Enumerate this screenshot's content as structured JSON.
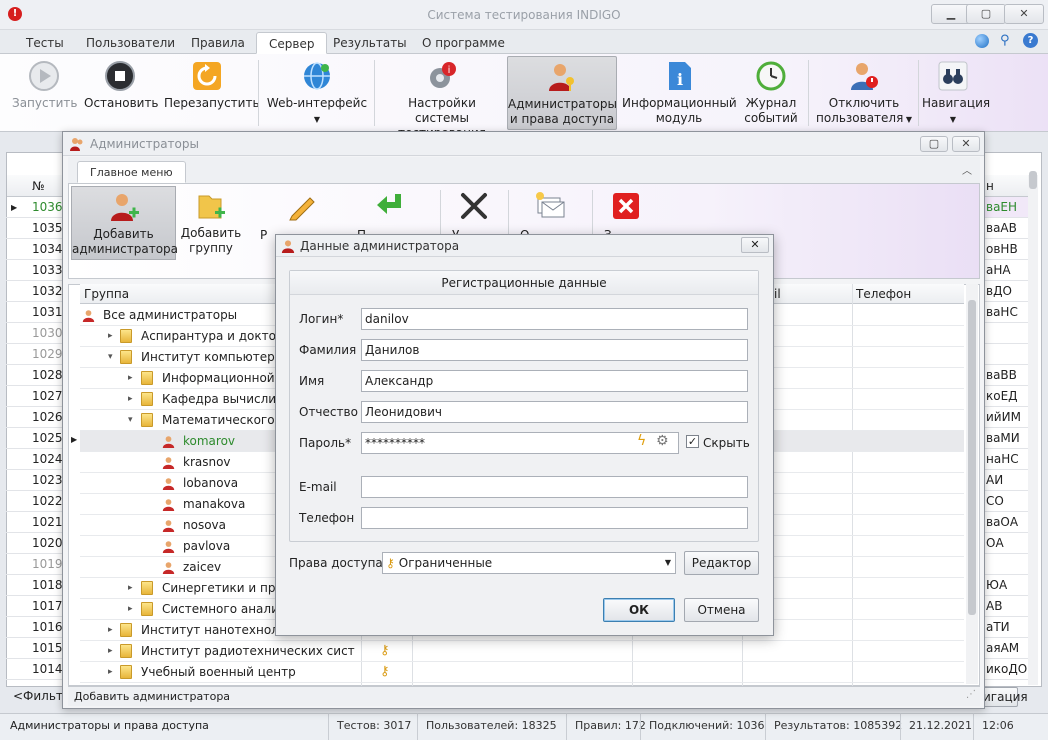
{
  "app": {
    "title": "Система тестирования INDIGO"
  },
  "main_tabs": [
    "Тесты",
    "Пользователи",
    "Правила",
    "Сервер",
    "Результаты",
    "О программе"
  ],
  "ribbon": {
    "start": "Запустить",
    "stop": "Остановить",
    "restart": "Перезапустить",
    "web": "Web-интерфейс",
    "settings_1": "Настройки системы",
    "settings_2": "тестирования",
    "admins_1": "Администраторы",
    "admins_2": "и права доступа",
    "info_1": "Информационный",
    "info_2": "модуль",
    "log_1": "Журнал",
    "log_2": "событий",
    "disconnect_1": "Отключить",
    "disconnect_2": "пользователя",
    "nav": "Навигация"
  },
  "bg_grid": {
    "col_no": "№",
    "col_right": "н",
    "rows": [
      {
        "no": "1036",
        "right": "ваЕН",
        "green": true
      },
      {
        "no": "1035",
        "right": "ваАВ"
      },
      {
        "no": "1034",
        "right": "овНВ"
      },
      {
        "no": "1033",
        "right": "аНА"
      },
      {
        "no": "1032",
        "right": "вДО"
      },
      {
        "no": "1031",
        "right": "ваНС"
      },
      {
        "no": "1030",
        "right": "",
        "grey": true
      },
      {
        "no": "1029",
        "right": "",
        "grey": true
      },
      {
        "no": "1028",
        "right": "ваВВ"
      },
      {
        "no": "1027",
        "right": "коЕД"
      },
      {
        "no": "1026",
        "right": "ийИМ"
      },
      {
        "no": "1025",
        "right": "ваМИ"
      },
      {
        "no": "1024",
        "right": "наНС"
      },
      {
        "no": "1023",
        "right": "АИ"
      },
      {
        "no": "1022",
        "right": "СО"
      },
      {
        "no": "1021",
        "right": "ваОА"
      },
      {
        "no": "1020",
        "right": "ОА"
      },
      {
        "no": "1019",
        "right": "",
        "grey": true
      },
      {
        "no": "1018",
        "right": "ЮА"
      },
      {
        "no": "1017",
        "right": "АВ"
      },
      {
        "no": "1016",
        "right": "аТИ"
      },
      {
        "no": "1015",
        "right": "аяАМ"
      },
      {
        "no": "1014",
        "right": "икоДО"
      }
    ],
    "filter": "<Фильтр",
    "nav_btn": "игация"
  },
  "admin_window": {
    "title": "Администраторы",
    "ribbon_tab": "Главное меню",
    "add_admin_1": "Добавить",
    "add_admin_2": "администратора",
    "add_group_1": "Добавить",
    "add_group_2": "группу",
    "edit_partial": "Р",
    "b4_partial": "П",
    "b5_partial": "У",
    "b6_partial": "О",
    "b7_partial": "З",
    "tree_headers": {
      "group": "Группа",
      "email": "il",
      "phone": "Телефон"
    },
    "tree": [
      {
        "label": "Все администраторы",
        "type": "usergroup",
        "level": 0
      },
      {
        "label": "Аспирантура и докторант",
        "type": "folder",
        "level": 1,
        "exp": "▸"
      },
      {
        "label": "Институт компьютерных т",
        "type": "folder",
        "level": 1,
        "exp": "▾"
      },
      {
        "label": "Информационной без",
        "type": "folder",
        "level": 2,
        "exp": "▸"
      },
      {
        "label": "Кафедра вычислите",
        "type": "folder",
        "level": 2,
        "exp": "▸"
      },
      {
        "label": "Математического обе",
        "type": "folder",
        "level": 2,
        "exp": "▾"
      },
      {
        "label": "komarov",
        "type": "user",
        "level": 3,
        "selected": true
      },
      {
        "label": "krasnov",
        "type": "user",
        "level": 3
      },
      {
        "label": "lobanova",
        "type": "user",
        "level": 3
      },
      {
        "label": "manakova",
        "type": "user",
        "level": 3
      },
      {
        "label": "nosova",
        "type": "user",
        "level": 3
      },
      {
        "label": "pavlova",
        "type": "user",
        "level": 3
      },
      {
        "label": "zaicev",
        "type": "user",
        "level": 3
      },
      {
        "label": "Синергетики и процес",
        "type": "folder",
        "level": 2,
        "exp": "▸"
      },
      {
        "label": "Системного анализа",
        "type": "folder",
        "level": 2,
        "exp": "▸"
      },
      {
        "label": "Институт нанотехнологий",
        "type": "folder",
        "level": 1,
        "exp": "▸"
      },
      {
        "label": "Институт радиотехнических систем",
        "type": "folder",
        "level": 1,
        "exp": "▸",
        "key": true
      },
      {
        "label": "Учебный военный центр",
        "type": "folder",
        "level": 1,
        "exp": "▸",
        "key": true
      }
    ],
    "status": "Добавить администратора"
  },
  "dialog": {
    "title": "Данные администратора",
    "group_caption": "Регистрационные данные",
    "login_label": "Логин*",
    "login_value": "danilov",
    "surname_label": "Фамилия",
    "surname_value": "Данилов",
    "name_label": "Имя",
    "name_value": "Александр",
    "patronymic_label": "Отчество",
    "patronymic_value": "Леонидович",
    "password_label": "Пароль*",
    "password_value": "**********",
    "hide_label": "Скрыть",
    "email_label": "E-mail",
    "email_value": "",
    "phone_label": "Телефон",
    "phone_value": "",
    "rights_label": "Права доступа",
    "rights_value": "Ограниченные",
    "editor_btn": "Редактор",
    "ok_btn": "ОК",
    "cancel_btn": "Отмена"
  },
  "statusbar": {
    "section": "Администраторы и права доступа",
    "tests": "Тестов: 3017",
    "users": "Пользователей: 18325",
    "rules": "Правил: 172",
    "connections": "Подключений: 1036",
    "results": "Результатов: 1085392",
    "date": "21.12.2021",
    "time": "12:06"
  },
  "colors": {
    "green_text": "#2e8b2e",
    "accent_red": "#e02020"
  }
}
